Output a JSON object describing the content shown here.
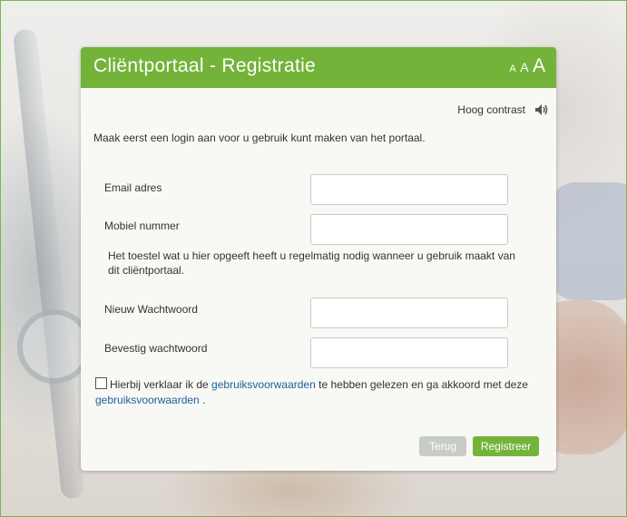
{
  "header": {
    "title": "Cliëntportaal - Registratie",
    "font_sizes": [
      "A",
      "A",
      "A"
    ]
  },
  "accessibility": {
    "contrast_label": "Hoog contrast",
    "speaker_icon": "speaker-icon"
  },
  "intro_text": "Maak eerst een login aan voor u gebruik kunt maken van het portaal.",
  "form": {
    "email": {
      "label": "Email adres",
      "value": ""
    },
    "mobile": {
      "label": "Mobiel nummer",
      "value": ""
    },
    "mobile_hint": "Het toestel wat u hier opgeeft heeft u regelmatig nodig wanneer u gebruik maakt van dit cliëntportaal.",
    "new_password": {
      "label": "Nieuw Wachtwoord",
      "value": ""
    },
    "confirm_password": {
      "label": "Bevestig wachtwoord",
      "value": ""
    }
  },
  "terms": {
    "checked": false,
    "text_before": "Hierbij verklaar ik de",
    "link1": "gebruiksvoorwaarden",
    "text_middle": "te hebben gelezen en ga akkoord met deze",
    "link2": "gebruiksvoorwaarden",
    "text_after": "."
  },
  "buttons": {
    "back": "Terug",
    "register": "Registreer"
  },
  "colors": {
    "brand_green": "#74b339",
    "link_blue": "#1f5f9f",
    "disabled_button": "#c8ccc6"
  }
}
